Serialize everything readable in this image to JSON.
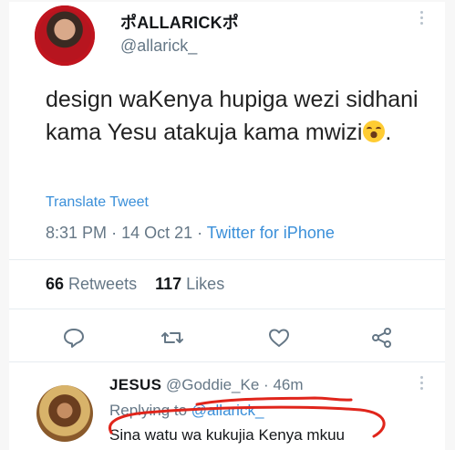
{
  "tweet": {
    "display_name": "ポALLARICKポ",
    "handle": "@allarick_",
    "text": "design waKenya hupiga wezi sidhani kama Yesu atakuja kama mwizi",
    "text_tail": ".",
    "translate_label": "Translate Tweet",
    "time": "8:31 PM",
    "date": "14 Oct 21",
    "source": "Twitter for iPhone",
    "retweets_count": "66",
    "retweets_label": "Retweets",
    "likes_count": "117",
    "likes_label": "Likes"
  },
  "reply": {
    "display_name": "JESUS",
    "handle": "@Goddie_Ke",
    "age": "46m",
    "replying_prefix": "Replying to",
    "replying_handle": "@allarick_",
    "text": "Sina watu wa kukujia Kenya mkuu"
  },
  "icons": [
    "more-icon",
    "emoji-laughing-icon",
    "reply-icon",
    "retweet-icon",
    "like-icon",
    "share-icon"
  ],
  "colors": {
    "link": "#3a8fd9",
    "muted": "#657786",
    "scribble": "#e0251b"
  }
}
